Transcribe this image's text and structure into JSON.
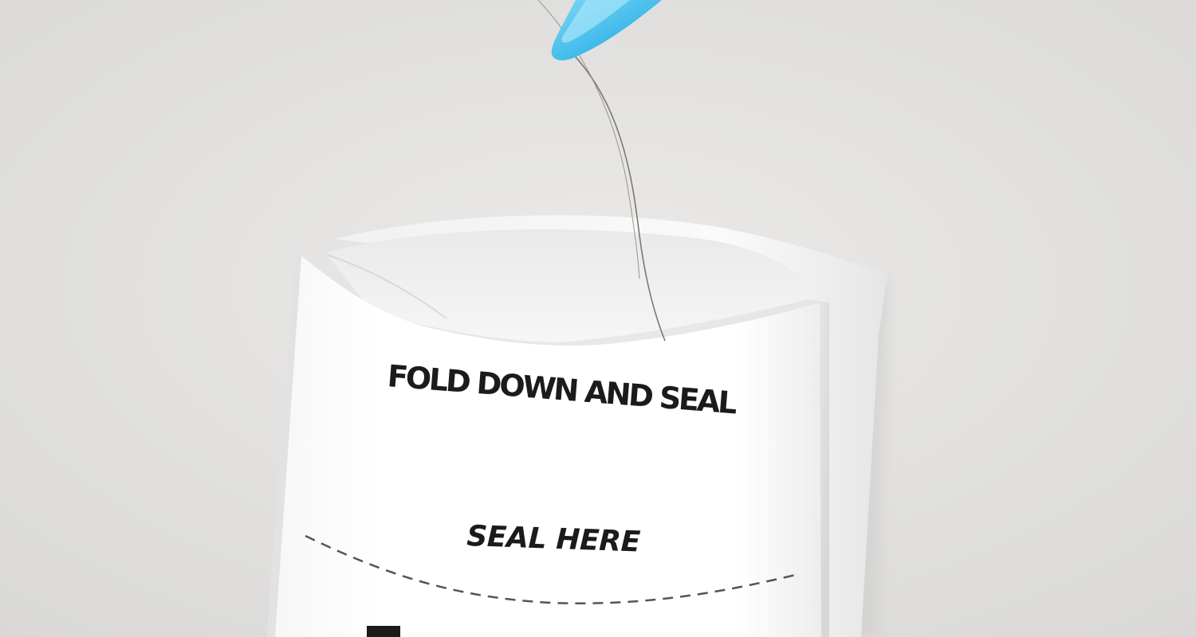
{
  "packet": {
    "fold_instruction": "FOLD DOWN AND SEAL",
    "seal_instruction": "SEAL HERE"
  },
  "colors": {
    "background": "#e4e3e1",
    "paper": "#ffffff",
    "tweezers": "#4cc3ee",
    "print": "#1b1b1b"
  }
}
